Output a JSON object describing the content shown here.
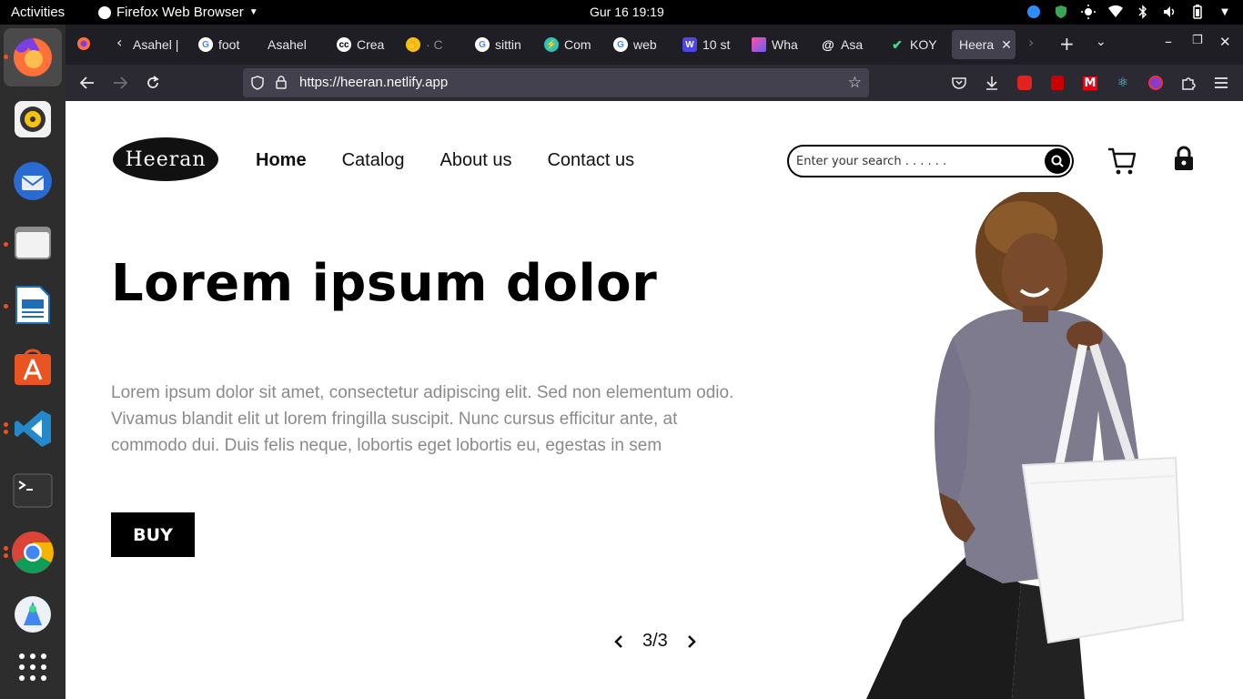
{
  "system_bar": {
    "activities": "Activities",
    "app_name": "Firefox Web Browser",
    "clock": "Gur 16  19:19"
  },
  "browser": {
    "tabs": [
      {
        "label": "Asahel |",
        "icon": "tab-back-icon"
      },
      {
        "label": "foot",
        "icon": "google-icon"
      },
      {
        "label": "Asahel",
        "icon": "none"
      },
      {
        "label": "Crea",
        "icon": "cc-icon"
      },
      {
        "label": "· C",
        "icon": "emoji-icon"
      },
      {
        "label": "sittin",
        "icon": "google-icon"
      },
      {
        "label": "Com",
        "icon": "bolt-icon"
      },
      {
        "label": "web",
        "icon": "google-icon"
      },
      {
        "label": "10 st",
        "icon": "w-icon"
      },
      {
        "label": "Wha",
        "icon": "figma-icon"
      },
      {
        "label": "Asa",
        "icon": "at-icon"
      },
      {
        "label": "KOY",
        "icon": "check-icon"
      },
      {
        "label": "Heera",
        "icon": "none"
      }
    ],
    "url": "https://heeran.netlify.app"
  },
  "site": {
    "logo_text": "Heeran",
    "nav": {
      "home": "Home",
      "catalog": "Catalog",
      "about": "About us",
      "contact": "Contact us"
    },
    "search_placeholder": "Enter your search . . . . . .",
    "hero": {
      "title": "Lorem ipsum dolor",
      "body": "Lorem ipsum dolor sit amet, consectetur adipiscing elit. Sed non elementum odio. Vivamus blandit elit ut lorem fringilla suscipit. Nunc cursus efficitur ante, at commodo dui. Duis felis neque, lobortis eget lobortis eu, egestas in sem",
      "buy": "BUY"
    },
    "pager": "3/3"
  },
  "colors": {
    "accent": "#000000",
    "body_text": "#8a8a8a",
    "firefox_tabbar": "#1f1e25",
    "firefox_toolbar": "#2b2a33",
    "dock": "#2d2d2d"
  }
}
